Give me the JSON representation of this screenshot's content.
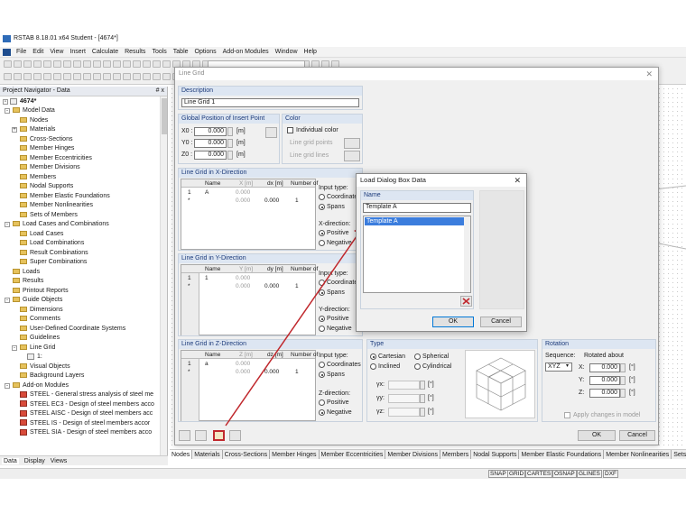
{
  "app": {
    "title": "RSTAB 8.18.01 x64 Student - [4674*]",
    "menu": [
      "File",
      "Edit",
      "View",
      "Insert",
      "Calculate",
      "Results",
      "Tools",
      "Table",
      "Options",
      "Add-on Modules",
      "Window",
      "Help"
    ]
  },
  "navigator": {
    "title": "Project Navigator - Data",
    "pin": "# x",
    "root": "4674*",
    "items": [
      {
        "label": "Model Data",
        "level": 1,
        "type": "folder",
        "expand": "-"
      },
      {
        "label": "Nodes",
        "level": 2,
        "type": "folder"
      },
      {
        "label": "Materials",
        "level": 2,
        "type": "folder",
        "expand": "+"
      },
      {
        "label": "Cross-Sections",
        "level": 2,
        "type": "folder"
      },
      {
        "label": "Member Hinges",
        "level": 2,
        "type": "folder"
      },
      {
        "label": "Member Eccentricities",
        "level": 2,
        "type": "folder"
      },
      {
        "label": "Member Divisions",
        "level": 2,
        "type": "folder"
      },
      {
        "label": "Members",
        "level": 2,
        "type": "folder"
      },
      {
        "label": "Nodal Supports",
        "level": 2,
        "type": "folder"
      },
      {
        "label": "Member Elastic Foundations",
        "level": 2,
        "type": "folder"
      },
      {
        "label": "Member Nonlinearities",
        "level": 2,
        "type": "folder"
      },
      {
        "label": "Sets of Members",
        "level": 2,
        "type": "folder"
      },
      {
        "label": "Load Cases and Combinations",
        "level": 1,
        "type": "folder",
        "expand": "-"
      },
      {
        "label": "Load Cases",
        "level": 2,
        "type": "folder"
      },
      {
        "label": "Load Combinations",
        "level": 2,
        "type": "folder"
      },
      {
        "label": "Result Combinations",
        "level": 2,
        "type": "folder"
      },
      {
        "label": "Super Combinations",
        "level": 2,
        "type": "folder"
      },
      {
        "label": "Loads",
        "level": 1,
        "type": "folder"
      },
      {
        "label": "Results",
        "level": 1,
        "type": "folder"
      },
      {
        "label": "Printout Reports",
        "level": 1,
        "type": "folder"
      },
      {
        "label": "Guide Objects",
        "level": 1,
        "type": "folder",
        "expand": "-"
      },
      {
        "label": "Dimensions",
        "level": 2,
        "type": "folder"
      },
      {
        "label": "Comments",
        "level": 2,
        "type": "folder"
      },
      {
        "label": "User-Defined Coordinate Systems",
        "level": 2,
        "type": "folder"
      },
      {
        "label": "Guidelines",
        "level": 2,
        "type": "folder"
      },
      {
        "label": "Line Grid",
        "level": 2,
        "type": "folder",
        "expand": "-"
      },
      {
        "label": "1:",
        "level": 3,
        "type": "item"
      },
      {
        "label": "Visual Objects",
        "level": 2,
        "type": "folder"
      },
      {
        "label": "Background Layers",
        "level": 2,
        "type": "folder"
      },
      {
        "label": "Add-on Modules",
        "level": 1,
        "type": "folder",
        "expand": "-"
      },
      {
        "label": "STEEL - General stress analysis of steel me",
        "level": 2,
        "type": "module"
      },
      {
        "label": "STEEL EC3 - Design of steel members acco",
        "level": 2,
        "type": "module"
      },
      {
        "label": "STEEL AISC - Design of steel members acc",
        "level": 2,
        "type": "module"
      },
      {
        "label": "STEEL IS - Design of steel members accor",
        "level": 2,
        "type": "module"
      },
      {
        "label": "STEEL SIA - Design of steel members acco",
        "level": 2,
        "type": "module"
      }
    ],
    "tabs": [
      "Data",
      "Display",
      "Views"
    ]
  },
  "bottom_tabs": [
    "Nodes",
    "Materials",
    "Cross-Sections",
    "Member Hinges",
    "Member Eccentricities",
    "Member Divisions",
    "Members",
    "Nodal Supports",
    "Member Elastic Foundations",
    "Member Nonlinearities",
    "Sets of Members"
  ],
  "status_buttons": [
    "SNAP",
    "GRID",
    "CARTES",
    "OSNAP",
    "GLINES",
    "DXF"
  ],
  "line_grid": {
    "title": "Line Grid",
    "description_header": "Description",
    "description_value": "Line Grid 1",
    "global_position_header": "Global Position of Insert Point",
    "x0_label": "X0 :",
    "y0_label": "Y0 :",
    "z0_label": "Z0 :",
    "x0": "0.000",
    "y0": "0.000",
    "z0": "0.000",
    "unit": "[m]",
    "color_header": "Color",
    "individual_color": "Individual color",
    "grid_points": "Line grid points",
    "grid_lines": "Line grid lines",
    "x_section": {
      "header": "Line Grid in X-Direction",
      "cols": [
        "Name",
        "X [m]",
        "dx [m]",
        "Number of"
      ],
      "row1": {
        "num": "1",
        "name": "A",
        "v": "0.000"
      },
      "row2": {
        "num": "*",
        "v": "0.000",
        "d": "0.000",
        "n": "1"
      },
      "input_type": "Input type:",
      "coords": "Coordinates",
      "spans": "Spans",
      "direction": "X-direction:",
      "positive": "Positive",
      "negative": "Negative"
    },
    "y_section": {
      "header": "Line Grid in Y-Direction",
      "cols": [
        "Name",
        "Y [m]",
        "dy [m]",
        "Number of"
      ],
      "row1": {
        "num": "1",
        "name": "1",
        "v": "0.000"
      },
      "row2": {
        "num": "*",
        "v": "0.000",
        "d": "0.000",
        "n": "1"
      },
      "input_type": "Input type:",
      "coords": "Coordinates",
      "spans": "Spans",
      "direction": "Y-direction:",
      "positive": "Positive",
      "negative": "Negative"
    },
    "z_section": {
      "header": "Line Grid in Z-Direction",
      "cols": [
        "Name",
        "Z [m]",
        "dz [m]",
        "Number of"
      ],
      "row1": {
        "num": "1",
        "name": "a",
        "v": "0.000"
      },
      "row2": {
        "num": "*",
        "v": "0.000",
        "d": "0.000",
        "n": "1"
      },
      "input_type": "Input type:",
      "coords": "Coordinates",
      "spans": "Spans",
      "direction": "Z-direction:",
      "positive": "Positive",
      "negative": "Negative"
    },
    "type_header": "Type",
    "cartesian": "Cartesian",
    "spherical": "Spherical",
    "inclined": "Inclined",
    "cylindrical": "Cylindrical",
    "gx_label": "γx:",
    "gy_label": "γy:",
    "gz_label": "γz:",
    "deg": "[°]",
    "rotation_header": "Rotation",
    "sequence_label": "Sequence:",
    "sequence_value": "XYZ",
    "rotated_about": "Rotated about",
    "rx_label": "X:",
    "ry_label": "Y:",
    "rz_label": "Z:",
    "rx": "0.000",
    "ry": "0.000",
    "rz": "0.000",
    "apply_changes": "Apply changes in model",
    "ok": "OK",
    "cancel": "Cancel"
  },
  "load_dialog": {
    "title": "Load Dialog Box Data",
    "name_header": "Name",
    "name_value": "Template A",
    "items": [
      "Template A"
    ],
    "ok": "OK",
    "cancel": "Cancel"
  },
  "colors": {
    "highlight": "#3b7ddd",
    "arrow": "#c0282d",
    "header_bg": "#dde6f2",
    "header_text": "#1b3a7a"
  }
}
